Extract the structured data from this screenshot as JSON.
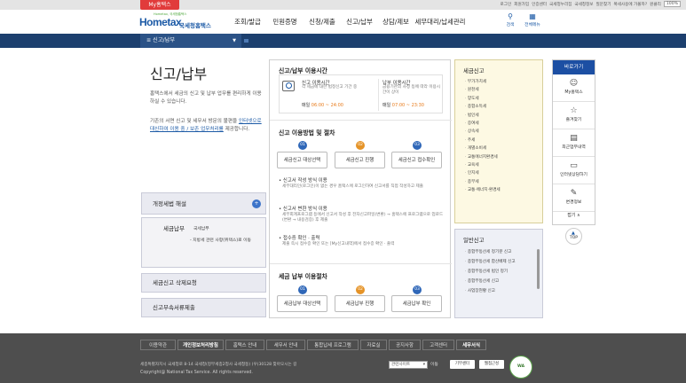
{
  "top_tag": "My홈택스",
  "util": {
    "links": [
      "로그인",
      "회원가입",
      "인증센터",
      "국세청누리집",
      "국세청정보",
      "질문찾기",
      "복세사용에 가볼까?",
      "원클리"
    ],
    "zoom": "100%"
  },
  "brand": {
    "name_en": "Hometax",
    "name_ko": "국세청홈택스",
    "slogan": "Hometax, 국세청홈택스"
  },
  "gnb": [
    "조회/발급",
    "민원증명",
    "신청/제출",
    "신고/납부",
    "상담/제보",
    "세무대리/납세관리"
  ],
  "global_buttons": {
    "search": "검색",
    "all_menu": "전체메뉴"
  },
  "lnb": {
    "current": "신고/납부"
  },
  "page": {
    "title": "신고/납부",
    "desc1": "홈택스에서 세금의 신고 및 납부 업무를 편리하게 이용하실 수 있습니다.",
    "desc2_a": "기존의 서면 신고 및 세무서 방문의 불편을 ",
    "desc2_link": "인터넷으로 대신하여 이용 중 / 보존 업무처리를",
    "desc2_b": " 제공합니다."
  },
  "side": {
    "item1": "개정세법 해설",
    "item2": "세금납부",
    "item2_sub1": "국세납부",
    "item2_sub2": "- 지방세 관련 사항(위택스)로 이동",
    "item3": "세금신고 삭제요청",
    "item4": "신고부속서류제출"
  },
  "usage_time": {
    "heading": "신고/납부 이용시간",
    "box1_title": "신고 이용시간",
    "box1_sub": "각 세금에 대한 법정신고 기간 중",
    "box1_time_label": "매일",
    "box1_time": "06:00 ~ 24:00",
    "box2_title": "납부 이용시간",
    "box2_sub": "금융기관의 사정 등에 따라 이용시간이 상이",
    "box2_time_label": "매일",
    "box2_time": "07:00 ~ 23:30"
  },
  "procedure": {
    "heading": "신고 이용방법 및 절차",
    "steps": [
      {
        "num": "01",
        "label": "세금신고 대상선택"
      },
      {
        "num": "02",
        "label": "세금신고 진행"
      },
      {
        "num": "03",
        "label": "세금신고 접수확인"
      }
    ],
    "bullets": [
      {
        "title": "• 신고서 작성 방식 이용",
        "sub": "세무대리인(로그인)이 없는 경우 홈택스에 로그인하여 신고서를 직접 작성하고 제출"
      },
      {
        "title": "• 신고서 변환 방식 이용",
        "sub": "세무회계프로그램 등에서 신고서 작성 후 전자신고파일(변환) → 홈택스에 프로그램으로 업로드(변환 → 내용검증) 후 제출"
      },
      {
        "title": "• 접수증 확인 · 출력",
        "sub": "제출 즉시 접수증 확인 또는 [My신고내역]에서 접수증 확인 · 출력"
      }
    ]
  },
  "payment_procedure": {
    "heading": "세금 납부 이용절차",
    "steps": [
      {
        "num": "01",
        "label": "세금납부 대상선택"
      },
      {
        "num": "02",
        "label": "세금납부 진행"
      },
      {
        "num": "03",
        "label": "세금납부 확인"
      }
    ]
  },
  "tax_return": {
    "heading": "세금신고",
    "items": [
      "부가가치세",
      "원천세",
      "양도세",
      "종합소득세",
      "법인세",
      "증여세",
      "상속세",
      "주세",
      "개별소비세",
      "교통에너지환경세",
      "교육세",
      "인지세",
      "종부세",
      "교통·에너지·환경세"
    ]
  },
  "general_return": {
    "heading": "일반신고",
    "items": [
      "종합부동산세 정기분 신고",
      "종합부동산세 합산배제 신고",
      "종합부동산세 법인 정기",
      "종합부동산세 신고",
      "사업장현황 신고"
    ]
  },
  "quick": {
    "heading": "바로가기",
    "items": [
      {
        "label": "My홈택스",
        "icon": "person-icon"
      },
      {
        "label": "즐겨찾기",
        "icon": "star-icon"
      },
      {
        "label": "최근업무내역",
        "icon": "history-icon"
      },
      {
        "label": "인터넷상담하기",
        "icon": "chat-icon"
      },
      {
        "label": "변경정보",
        "icon": "change-icon"
      }
    ],
    "more": "접기 ∧",
    "top": "TOP"
  },
  "footer": {
    "nav": [
      "이용약관",
      "개인정보처리방침",
      "홈택스 안내",
      "세무서 안내",
      "통합납세 프로그램",
      "자료실",
      "공지사항",
      "고객센터",
      "세무서식"
    ],
    "address": "세종특별자치시 국세청로 8-14 국세청(정부세종2청사 국세청동) (우)30128   찾아오시는 길",
    "copyright": "Copyright@ National Tax Service. All rights reserved.",
    "select_placeholder": "관련사이트",
    "go": "이동",
    "badges": [
      "기부센터",
      "웹접근성"
    ],
    "cert": "WA"
  }
}
